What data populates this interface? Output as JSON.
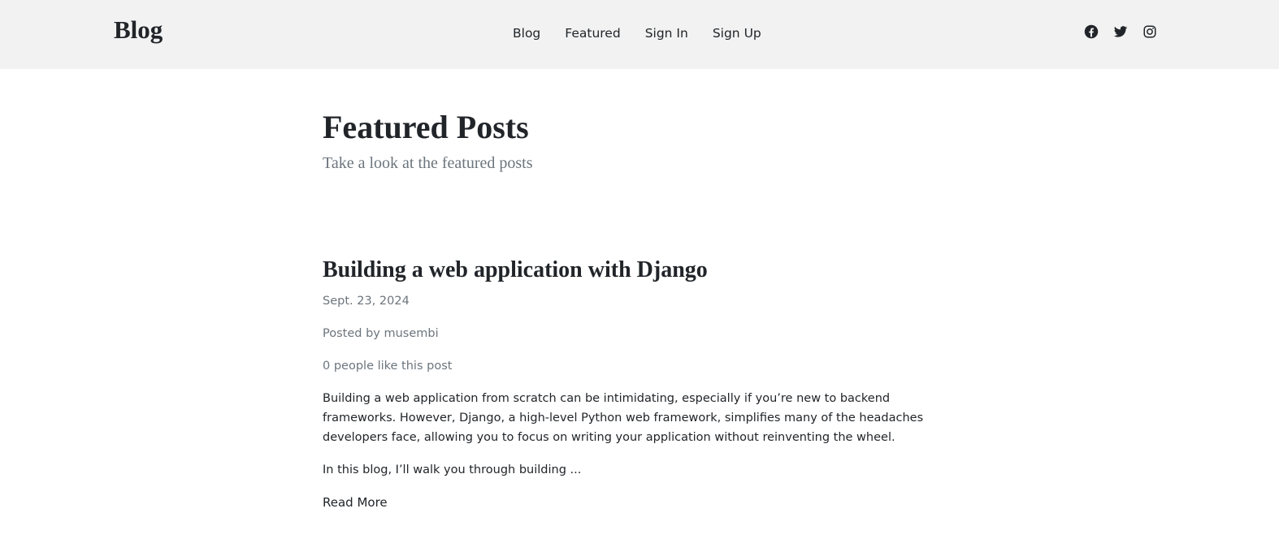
{
  "header": {
    "brand": "Blog",
    "nav": [
      {
        "label": "Blog"
      },
      {
        "label": "Featured"
      },
      {
        "label": "Sign In"
      },
      {
        "label": "Sign Up"
      }
    ],
    "social": [
      "facebook-icon",
      "twitter-icon",
      "instagram-icon"
    ]
  },
  "main": {
    "title": "Featured Posts",
    "subtitle": "Take a look at the featured posts",
    "posts": [
      {
        "title": "Building a web application with Django",
        "date": "Sept. 23, 2024",
        "author": "Posted by musembi",
        "likes": "0 people like this post",
        "body": "Building a web application from scratch can be intimidating, especially if you’re new to backend frameworks. However, Django, a high-level Python web framework, simplifies many of the headaches developers face, allowing you to focus on writing your application without reinventing the wheel.",
        "excerpt": "In this blog, I’ll walk you through building ...",
        "read_more": "Read More"
      }
    ]
  },
  "colors": {
    "header_bg": "#f2f2f2",
    "text": "#212529",
    "muted": "#6c757d"
  }
}
